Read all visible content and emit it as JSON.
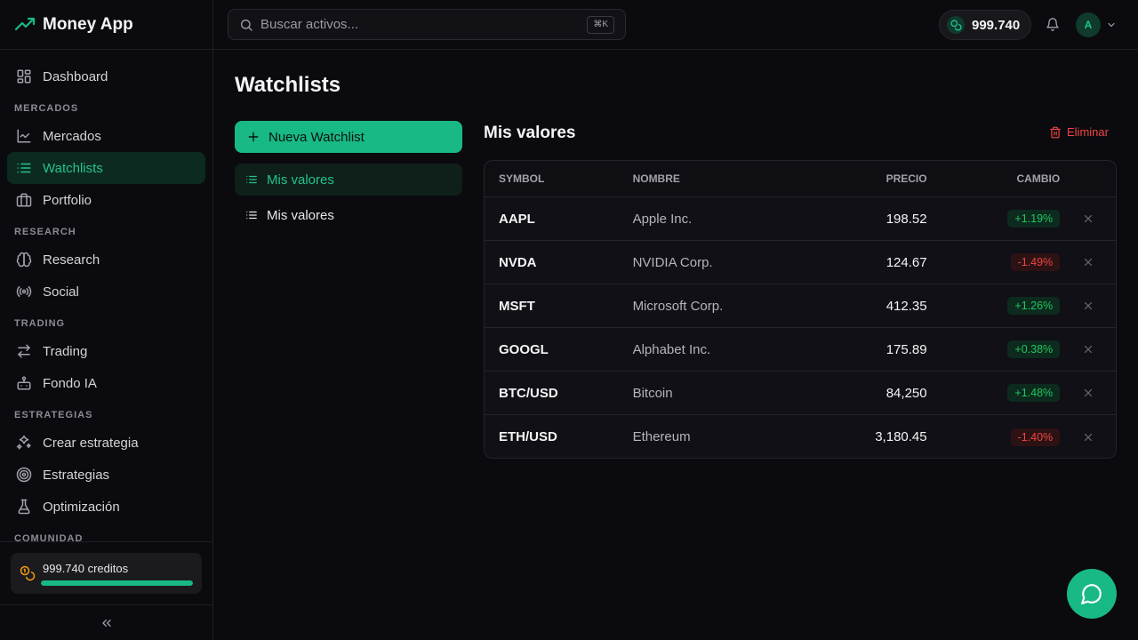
{
  "brand": {
    "name": "Money App",
    "accent": "#19b985"
  },
  "sidebar": {
    "items": [
      {
        "type": "item",
        "label": "Dashboard",
        "icon": "dashboard-icon"
      },
      {
        "type": "section",
        "label": "MERCADOS"
      },
      {
        "type": "item",
        "label": "Mercados",
        "icon": "line-chart-icon"
      },
      {
        "type": "item",
        "label": "Watchlists",
        "icon": "list-icon",
        "active": true
      },
      {
        "type": "item",
        "label": "Portfolio",
        "icon": "briefcase-icon"
      },
      {
        "type": "section",
        "label": "RESEARCH"
      },
      {
        "type": "item",
        "label": "Research",
        "icon": "brain-icon"
      },
      {
        "type": "item",
        "label": "Social",
        "icon": "radio-icon"
      },
      {
        "type": "section",
        "label": "TRADING"
      },
      {
        "type": "item",
        "label": "Trading",
        "icon": "arrows-swap-icon"
      },
      {
        "type": "item",
        "label": "Fondo IA",
        "icon": "bot-icon"
      },
      {
        "type": "section",
        "label": "ESTRATEGIAS"
      },
      {
        "type": "item",
        "label": "Crear estrategia",
        "icon": "sparkles-icon"
      },
      {
        "type": "item",
        "label": "Estrategias",
        "icon": "target-icon"
      },
      {
        "type": "item",
        "label": "Optimización",
        "icon": "flask-icon"
      },
      {
        "type": "section",
        "label": "COMUNIDAD"
      }
    ],
    "credits": {
      "label": "999.740 creditos",
      "progress": 0.9997
    }
  },
  "topbar": {
    "search_placeholder": "Buscar activos...",
    "shortcut": "⌘K",
    "balance": "999.740",
    "avatar_initial": "A"
  },
  "main": {
    "title": "Watchlists",
    "new_watchlist_label": "Nueva Watchlist",
    "watchlists": [
      {
        "label": "Mis valores",
        "active": true
      },
      {
        "label": "Mis valores",
        "active": false
      }
    ],
    "detail": {
      "title": "Mis valores",
      "delete_label": "Eliminar",
      "columns": {
        "symbol": "SYMBOL",
        "name": "NOMBRE",
        "price": "PRECIO",
        "change": "CAMBIO"
      },
      "rows": [
        {
          "symbol": "AAPL",
          "name": "Apple Inc.",
          "price": "198.52",
          "change": "+1.19%",
          "direction": "up"
        },
        {
          "symbol": "NVDA",
          "name": "NVIDIA Corp.",
          "price": "124.67",
          "change": "-1.49%",
          "direction": "down"
        },
        {
          "symbol": "MSFT",
          "name": "Microsoft Corp.",
          "price": "412.35",
          "change": "+1.26%",
          "direction": "up"
        },
        {
          "symbol": "GOOGL",
          "name": "Alphabet Inc.",
          "price": "175.89",
          "change": "+0.38%",
          "direction": "up"
        },
        {
          "symbol": "BTC/USD",
          "name": "Bitcoin",
          "price": "84,250",
          "change": "+1.48%",
          "direction": "up"
        },
        {
          "symbol": "ETH/USD",
          "name": "Ethereum",
          "price": "3,180.45",
          "change": "-1.40%",
          "direction": "down"
        }
      ]
    }
  },
  "colors": {
    "positive": "#22c55e",
    "negative": "#ef4444",
    "background": "#0b0b0f"
  }
}
